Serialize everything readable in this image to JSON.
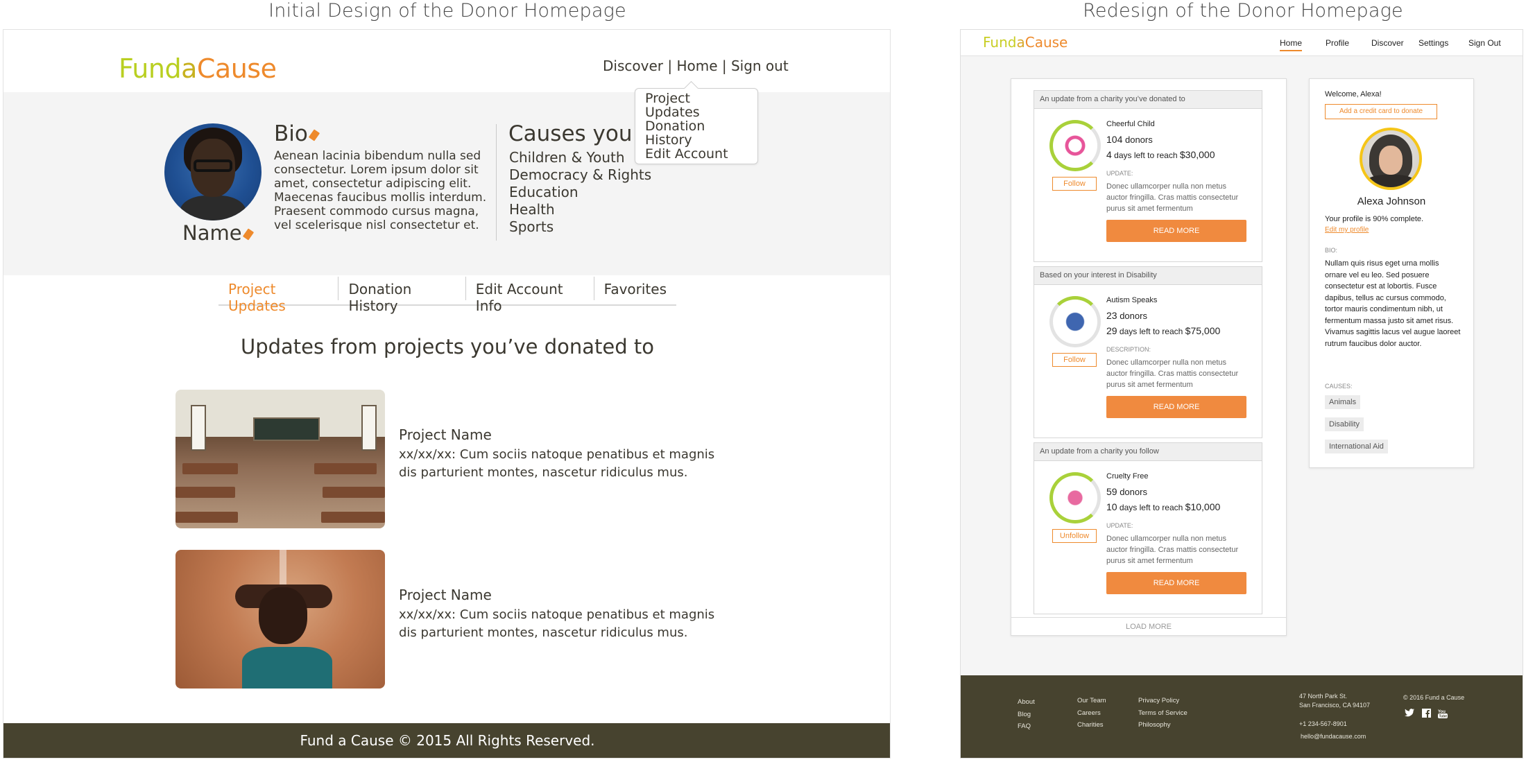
{
  "captions": {
    "left": "Initial Design of the Donor Homepage",
    "right": "Redesign of the Donor Homepage"
  },
  "left": {
    "logo": {
      "part1": "Fund",
      "part2": "a",
      "part3": "Cause"
    },
    "nav": {
      "discover": "Discover",
      "sep1": " | ",
      "home": "Home",
      "sep2": " | ",
      "signout": "Sign out"
    },
    "dropdown": [
      "Project Updates",
      "Donation",
      "History",
      "Edit Account"
    ],
    "profile": {
      "name": "Name",
      "bio_heading": "Bio",
      "bio_text": "Aenean lacinia bibendum nulla sed consectetur. Lorem ipsum dolor sit amet, consectetur adipiscing elit. Maecenas faucibus mollis interdum. Praesent commodo cursus magna, vel scelerisque nisl consectetur et.",
      "causes_heading": "Causes you care about",
      "causes": [
        "Children & Youth",
        "Democracy & Rights",
        "Education",
        "Health",
        "Sports"
      ]
    },
    "tabs": [
      "Project Updates",
      "Donation History",
      "Edit Account Info",
      "Favorites"
    ],
    "section_heading": "Updates from projects you’ve donated to",
    "projects": [
      {
        "name": "Project Name",
        "desc": "xx/xx/xx: Cum sociis natoque penatibus et magnis dis parturient montes, nascetur ridiculus mus."
      },
      {
        "name": "Project Name",
        "desc": "xx/xx/xx: Cum sociis natoque penatibus et magnis dis parturient montes, nascetur ridiculus mus."
      }
    ],
    "footer": "Fund a Cause © 2015 All Rights Reserved."
  },
  "right": {
    "logo": {
      "part1": "Fund",
      "part2": "a",
      "part3": "Cause"
    },
    "nav": [
      "Home",
      "Profile",
      "Discover",
      "Settings",
      "Sign Out"
    ],
    "cards": [
      {
        "header": "An update from a charity you’ve donated to",
        "charity": "Cheerful Child",
        "donors_num": "104",
        "donors_label": "donors",
        "days_num": "4",
        "days_label": "days left to reach",
        "goal": "$30,000",
        "follow": "Follow",
        "section_label": "UPDATE:",
        "text": "Donec ullamcorper nulla non metus auctor fringilla. Cras mattis consectetur purus sit amet fermentum",
        "button": "READ MORE",
        "logo_color": "#e7559a"
      },
      {
        "header": "Based on your interest in Disability",
        "charity": "Autism Speaks",
        "donors_num": "23",
        "donors_label": "donors",
        "days_num": "29",
        "days_label": "days left to reach",
        "goal": "$75,000",
        "follow": "Follow",
        "section_label": "DESCRIPTION:",
        "text": "Donec ullamcorper nulla non metus auctor fringilla. Cras mattis consectetur purus sit amet fermentum",
        "button": "READ MORE",
        "logo_color": "#3f66b0"
      },
      {
        "header": "An update from a charity you follow",
        "charity": "Cruelty Free",
        "donors_num": "59",
        "donors_label": "donors",
        "days_num": "10",
        "days_label": "days left to reach",
        "goal": "$10,000",
        "follow": "Unfollow",
        "section_label": "UPDATE:",
        "text": "Donec ullamcorper nulla non metus auctor fringilla. Cras mattis consectetur purus sit amet fermentum",
        "button": "READ MORE",
        "logo_color": "#e86aa0"
      }
    ],
    "load_more": "LOAD MORE",
    "sidebar": {
      "welcome": "Welcome, Alexa!",
      "add_card": "Add a credit card to donate",
      "name": "Alexa Johnson",
      "complete": "Your profile is 90% complete.",
      "edit_link": "Edit my profile",
      "bio_label": "BIO:",
      "bio": "Nullam quis risus eget urna mollis ornare vel eu leo. Sed posuere consectetur est at lobortis. Fusce dapibus, tellus ac cursus commodo, tortor mauris condimentum nibh, ut fermentum massa justo sit amet risus. Vivamus sagittis lacus vel augue laoreet rutrum faucibus dolor auctor.",
      "causes_label": "CAUSES:",
      "causes": [
        "Animals",
        "Disability",
        "International Aid"
      ]
    },
    "footer": {
      "col1": [
        "About",
        "Blog",
        "FAQ"
      ],
      "col2": [
        "Our Team",
        "Careers",
        "Charities"
      ],
      "col3": [
        "Privacy Policy",
        "Terms of Service",
        "Philosophy"
      ],
      "address1": "47 North Park St.",
      "address2": "San Francisco, CA 94107",
      "phone": "+1 234-567-8901",
      "email": "hello@fundacause.com",
      "copyright": "© 2016 Fund a Cause",
      "social_icons": [
        "twitter-icon",
        "facebook-icon",
        "youtube-icon"
      ]
    }
  }
}
